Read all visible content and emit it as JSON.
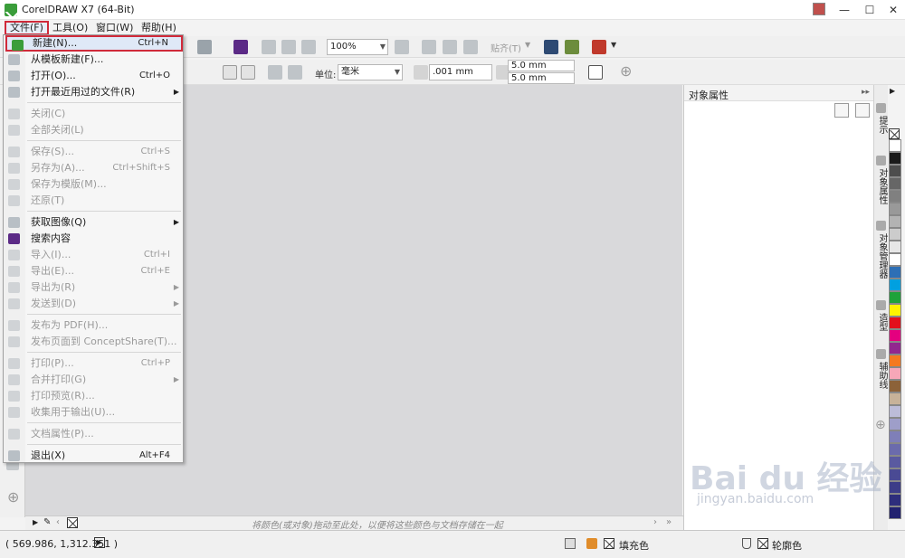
{
  "window": {
    "title": "CorelDRAW X7 (64-Bit)",
    "controls": [
      "—",
      "☐",
      "✕"
    ]
  },
  "menubar": [
    {
      "label": "文件(F)"
    },
    {
      "label": "工具(O)"
    },
    {
      "label": "窗口(W)"
    },
    {
      "label": "帮助(H)"
    }
  ],
  "toolbar": {
    "zoom": "100%",
    "snap": "贴齐(T)"
  },
  "propbar": {
    "units_label": "单位:",
    "units_value": "毫米",
    "nudge": ".001 mm",
    "dup_x": "5.0 mm",
    "dup_y": "5.0 mm"
  },
  "file_menu": {
    "items": [
      {
        "label": "新建(N)...",
        "shortcut": "Ctrl+N",
        "highlighted": true
      },
      {
        "label": "从模板新建(F)..."
      },
      {
        "label": "打开(O)...",
        "shortcut": "Ctrl+O"
      },
      {
        "label": "打开最近用过的文件(R)",
        "submenu": "▶"
      },
      {
        "label": "关闭(C)",
        "disabled": true
      },
      {
        "label": "全部关闭(L)",
        "disabled": true
      },
      {
        "label": "保存(S)...",
        "shortcut": "Ctrl+S",
        "disabled": true
      },
      {
        "label": "另存为(A)...",
        "shortcut": "Ctrl+Shift+S",
        "disabled": true
      },
      {
        "label": "保存为模版(M)...",
        "disabled": true
      },
      {
        "label": "还原(T)",
        "disabled": true
      },
      {
        "label": "获取图像(Q)",
        "submenu": "▶"
      },
      {
        "label": "搜索内容"
      },
      {
        "label": "导入(I)...",
        "shortcut": "Ctrl+I",
        "disabled": true
      },
      {
        "label": "导出(E)...",
        "shortcut": "Ctrl+E",
        "disabled": true
      },
      {
        "label": "导出为(R)",
        "submenu": "▶",
        "disabled": true
      },
      {
        "label": "发送到(D)",
        "submenu": "▶",
        "disabled": true
      },
      {
        "label": "发布为 PDF(H)...",
        "disabled": true
      },
      {
        "label": "发布页面到 ConceptShare(T)...",
        "disabled": true
      },
      {
        "label": "打印(P)...",
        "shortcut": "Ctrl+P",
        "disabled": true
      },
      {
        "label": "合并打印(G)",
        "submenu": "▶",
        "disabled": true
      },
      {
        "label": "打印预览(R)...",
        "disabled": true
      },
      {
        "label": "收集用于输出(U)...",
        "disabled": true
      },
      {
        "label": "文档属性(P)...",
        "disabled": true
      },
      {
        "label": "退出(X)",
        "shortcut": "Alt+F4"
      }
    ]
  },
  "docker": {
    "title": "对象属性"
  },
  "side_tabs": [
    "提示",
    "对象属性",
    "对象管理器",
    "造型",
    "辅助线"
  ],
  "palette": [
    "#ffffff",
    "#1a1a1a",
    "#4d4d4d",
    "#666666",
    "#808080",
    "#999999",
    "#b3b3b3",
    "#cccccc",
    "#e6e6e6",
    "#ffffff",
    "#2e6fb5",
    "#00a0e0",
    "#1fa23a",
    "#fff200",
    "#e3101c",
    "#e4007f",
    "#92278f",
    "#f47920",
    "#f6a7b8",
    "#8c6239",
    "#c7b299",
    "#bcbcd8",
    "#9e9ec9",
    "#7f7fb8",
    "#6b6bac",
    "#5a5aa0",
    "#4a4a94",
    "#3c3c88",
    "#2e2e7c",
    "#222270"
  ],
  "docbar": {
    "hint": "将颜色(或对象)拖动至此处，以便将这些颜色与文档存储在一起"
  },
  "status": {
    "coords": "( 569.986, 1,312.351 )",
    "fill_label": "填充色",
    "outline_label": "轮廓色"
  },
  "watermark": {
    "text": "Bai du 经验",
    "url": "jingyan.baidu.com"
  }
}
